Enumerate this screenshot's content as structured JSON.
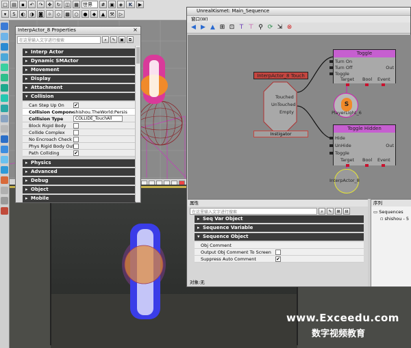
{
  "toolbar": {
    "world_select": "世界",
    "kismet_button": "K"
  },
  "properties": {
    "title": "InterpActor_8 Properties",
    "close_label": "×",
    "search_placeholder": "在这里输入文字进行搜索",
    "categories_top": [
      "Interp Actor",
      "Dynamic SMActor",
      "Movement",
      "Display",
      "Attachment"
    ],
    "expanded": {
      "label": "Collision",
      "rows": [
        {
          "name": "Can Step Up On",
          "checked": "✔"
        },
        {
          "name": "Collision Component",
          "value": "shishou.TheWorld:Persis"
        },
        {
          "name": "Collision Type",
          "value": "COLLIDE_TouchAll"
        },
        {
          "name": "Block Rigid Body",
          "checked": ""
        },
        {
          "name": "Collide Complex",
          "checked": ""
        },
        {
          "name": "No Encroach Check",
          "checked": ""
        },
        {
          "name": "Phys Rigid Body Out Of World",
          "checked": ""
        },
        {
          "name": "Path Colliding",
          "checked": "✔"
        }
      ]
    },
    "categories_bottom": [
      "Physics",
      "Advanced",
      "Debug",
      "Object",
      "Mobile"
    ]
  },
  "kismet": {
    "title": "UnrealKismet: Main_Sequence",
    "menu": "窗口(W)",
    "canvas": {
      "touch_event": {
        "title": "InterpActor_8 Touch",
        "outputs": [
          "Touched",
          "UnTouched",
          "Empty"
        ],
        "footer": "Instigator"
      },
      "toggle": {
        "title": "Toggle",
        "inputs": [
          "Turn On",
          "Turn Off",
          "Toggle"
        ],
        "output": "Out",
        "vars": [
          "Target",
          "Bool",
          "Event"
        ]
      },
      "toggle_hidden": {
        "title": "Toggle Hidden",
        "inputs": [
          "Hide",
          "UnHide",
          "Toggle"
        ],
        "output": "Out",
        "vars": [
          "Target",
          "Bool",
          "Event"
        ]
      },
      "var_player": "PlayerLight_6",
      "var_interp": "InterpActor_8"
    },
    "props": {
      "header": "属性",
      "search_placeholder": "在这里输入文字进行搜索",
      "categories": [
        "Seq Var Object",
        "Sequence Variable"
      ],
      "expanded_label": "Sequence Object",
      "rows": [
        {
          "name": "Obj Comment",
          "checked": ""
        },
        {
          "name": "Output Obj Comment To Screen",
          "checked": ""
        },
        {
          "name": "Suppress Auto Comment",
          "checked": "✔"
        }
      ],
      "status": "对象:无"
    },
    "sequences": {
      "header": "序列",
      "root": "Sequences",
      "child": "shishou - 5"
    }
  },
  "watermark": {
    "line1": "www.Exceedu.com",
    "line2": "数字视频教育"
  }
}
